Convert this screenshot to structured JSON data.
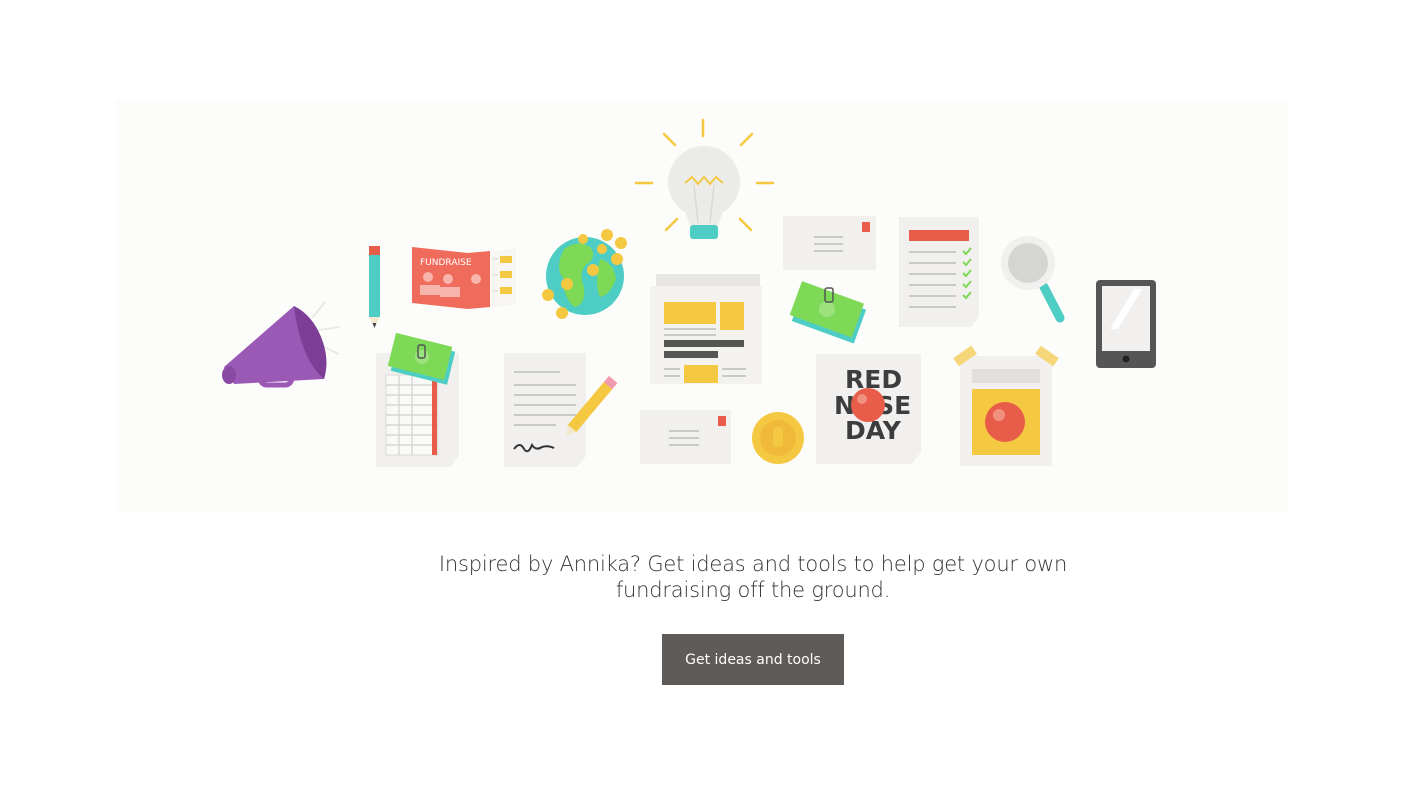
{
  "illustration": {
    "brochure_text": "FUNDRAISE",
    "poster_lines": [
      "RED",
      "NOSE",
      "DAY"
    ]
  },
  "promo": {
    "line1": "Inspired by Annika? Get ideas and tools to help get your own",
    "line2": "fundraising off the ground."
  },
  "cta": {
    "label": "Get ideas and tools"
  },
  "colors": {
    "button_bg": "#5e5b58",
    "megaphone": "#9b59b6",
    "accent_red": "#e85c4a",
    "accent_yellow": "#f5c842",
    "accent_teal": "#4ecdc4",
    "money_green": "#7ed957"
  }
}
